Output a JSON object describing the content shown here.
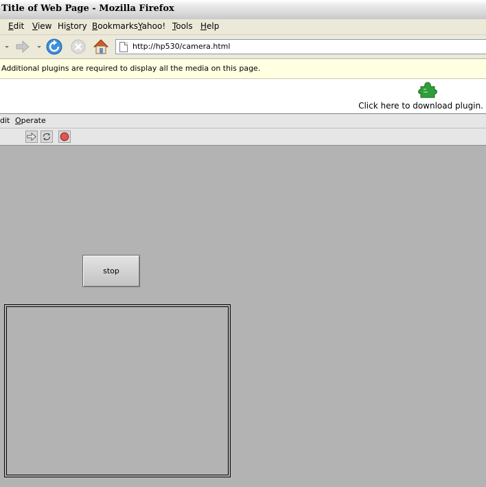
{
  "window": {
    "title": "Title of Web Page - Mozilla Firefox"
  },
  "menubar": {
    "items": [
      {
        "label": "Edit",
        "accel": "E",
        "rest": "dit"
      },
      {
        "label": "View",
        "accel": "V",
        "rest": "iew"
      },
      {
        "label": "History",
        "accel": "s",
        "pre": "Hi",
        "rest": "tory"
      },
      {
        "label": "Bookmarks",
        "accel": "B",
        "rest": "ookmarks"
      },
      {
        "label": "Yahoo!",
        "accel": "Y",
        "rest": "ahoo!"
      },
      {
        "label": "Tools",
        "accel": "T",
        "rest": "ools"
      },
      {
        "label": "Help",
        "accel": "H",
        "rest": "elp"
      }
    ]
  },
  "navbar": {
    "url": "http://hp530/camera.html"
  },
  "plugin_bar": {
    "message": "Additional plugins are required to display all the media on this page."
  },
  "plugin_area": {
    "link_text": "Click here to download plugin."
  },
  "lv_menubar": {
    "edit_partial": "dit",
    "operate_accel": "O",
    "operate_rest": "perate"
  },
  "panel": {
    "stop_label": "stop"
  },
  "colors": {
    "panel_bg": "#b3b3b3",
    "plugin_bar_bg": "#ffffe1",
    "puzzle_green": "#2e9e3a"
  }
}
